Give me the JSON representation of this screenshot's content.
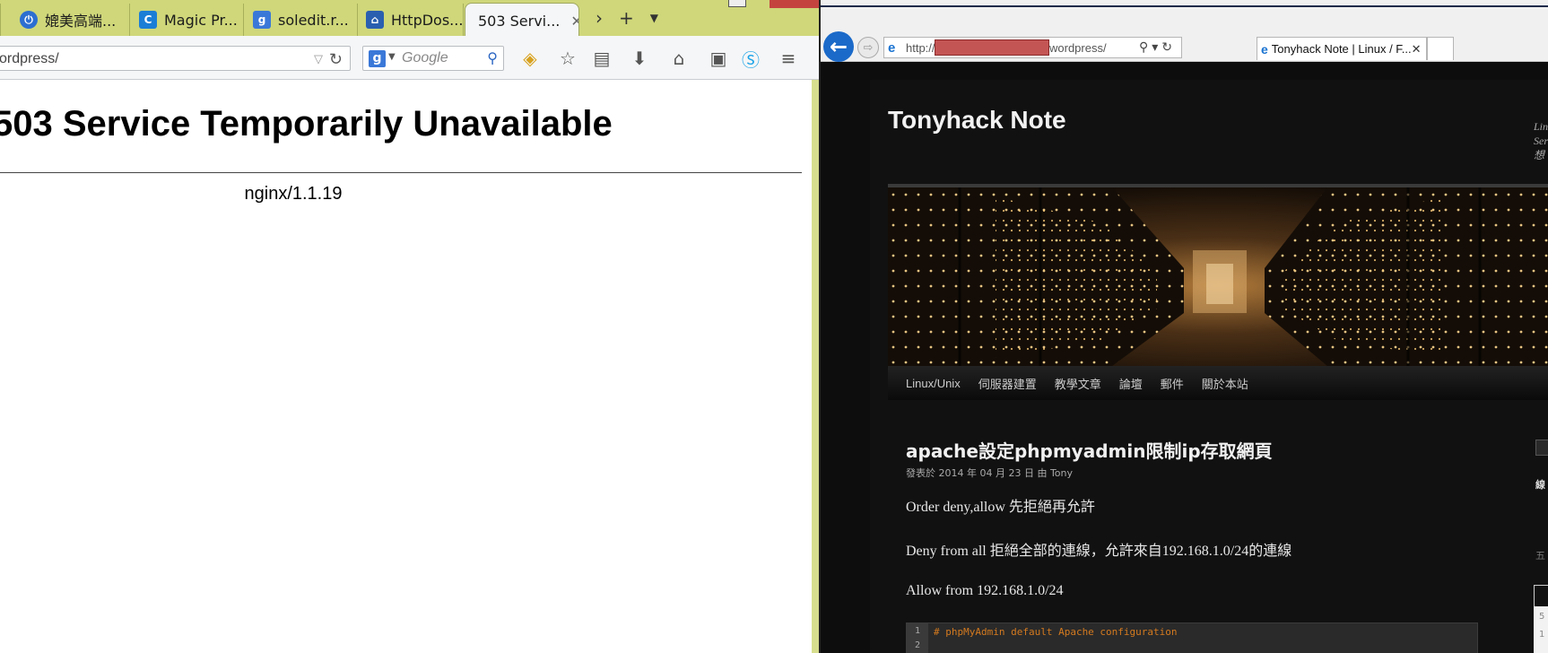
{
  "firefox": {
    "tabs": [
      {
        "label": "媲美高端...",
        "icon": "power-icon",
        "color": "#2c6fd1"
      },
      {
        "label": "Magic Pr...",
        "icon": "c-logo-icon",
        "color": "#1b7ed6"
      },
      {
        "label": "soledit.r...",
        "icon": "google-icon",
        "color": "#3a78d8"
      },
      {
        "label": "HttpDos...",
        "icon": "house-icon",
        "color": "#2a5fb0"
      },
      {
        "label": "503 Servi...",
        "icon": "none",
        "color": "#ffffff"
      }
    ],
    "new_tab_label": "+",
    "url": "ordpress/",
    "search_placeholder": "Google",
    "page": {
      "heading": "503 Service Temporarily Unavailable",
      "server": "nginx/1.1.19"
    }
  },
  "ie": {
    "address_prefix": "http://",
    "address_suffix": "wordpress/",
    "tab_title": "Tonyhack Note | Linux / F...",
    "site": {
      "title": "Tonyhack Note",
      "description": "Lin Ser 想",
      "nav": [
        "Linux/Unix",
        "伺服器建置",
        "教學文章",
        "論壇",
        "郵件",
        "關於本站"
      ],
      "post_title": "apache設定phpmyadmin限制ip存取網頁",
      "post_meta": "發表於 2014 年 04 月 23 日 由 Tony",
      "paragraphs": [
        "Order deny,allow 先拒絕再允許",
        "Deny from all 拒絕全部的連線，允許來自192.168.1.0/24的連線",
        "Allow from 192.168.1.0/24"
      ],
      "code_lines": [
        "# phpMyAdmin default Apache configuration"
      ],
      "code_line_numbers": [
        "1",
        "2"
      ],
      "sidebar_text1": "線",
      "sidebar_text2": "五",
      "sidebar_num1": "5",
      "sidebar_num2": "1"
    }
  },
  "colors": {
    "firefox_frame": "#cfd77a",
    "ie_back_button": "#1b6ac9",
    "redaction": "#c45555",
    "code_comment": "#d47a1f"
  }
}
